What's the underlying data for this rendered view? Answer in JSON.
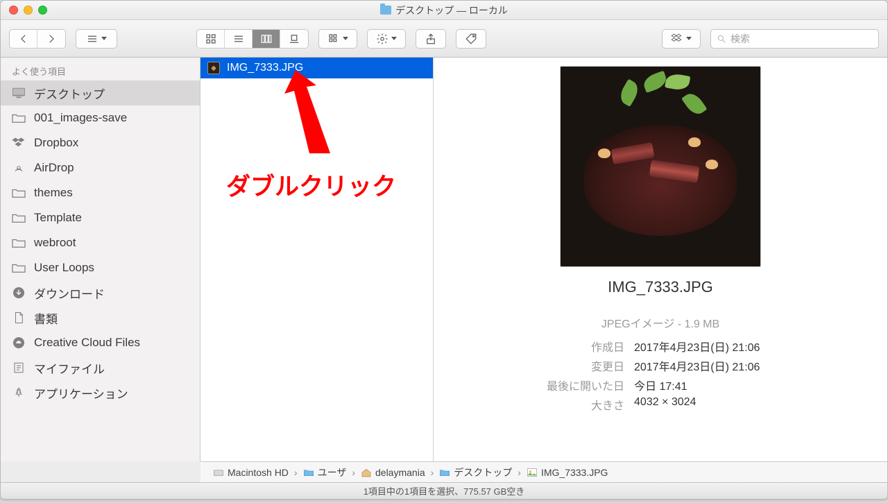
{
  "window": {
    "title": "デスクトップ — ローカル"
  },
  "search": {
    "placeholder": "検索"
  },
  "sidebar": {
    "header": "よく使う項目",
    "items": [
      {
        "label": "デスクトップ",
        "icon": "desktop",
        "active": true
      },
      {
        "label": "001_images-save",
        "icon": "folder"
      },
      {
        "label": "Dropbox",
        "icon": "dropbox"
      },
      {
        "label": "AirDrop",
        "icon": "airdrop"
      },
      {
        "label": "themes",
        "icon": "folder"
      },
      {
        "label": "Template",
        "icon": "folder"
      },
      {
        "label": "webroot",
        "icon": "folder"
      },
      {
        "label": "User Loops",
        "icon": "folder"
      },
      {
        "label": "ダウンロード",
        "icon": "download"
      },
      {
        "label": "書類",
        "icon": "document"
      },
      {
        "label": "Creative Cloud Files",
        "icon": "ccloud"
      },
      {
        "label": "マイファイル",
        "icon": "myfiles"
      },
      {
        "label": "アプリケーション",
        "icon": "app"
      }
    ]
  },
  "file": {
    "name": "IMG_7333.JPG"
  },
  "preview": {
    "title": "IMG_7333.JPG",
    "kind_size": "JPEGイメージ - 1.9 MB",
    "labels": {
      "created": "作成日",
      "modified": "変更日",
      "opened": "最後に開いた日",
      "dim": "大きさ"
    },
    "values": {
      "created": "2017年4月23日(日) 21:06",
      "modified": "2017年4月23日(日) 21:06",
      "opened": "今日 17:41",
      "dim": "4032 × 3024"
    }
  },
  "path": [
    {
      "label": "Macintosh HD",
      "icon": "disk"
    },
    {
      "label": "ユーザ",
      "icon": "folder"
    },
    {
      "label": "delaymania",
      "icon": "home"
    },
    {
      "label": "デスクトップ",
      "icon": "folder"
    },
    {
      "label": "IMG_7333.JPG",
      "icon": "image"
    }
  ],
  "status": "1項目中の1項目を選択、775.57 GB空き",
  "annotation": "ダブルクリック"
}
